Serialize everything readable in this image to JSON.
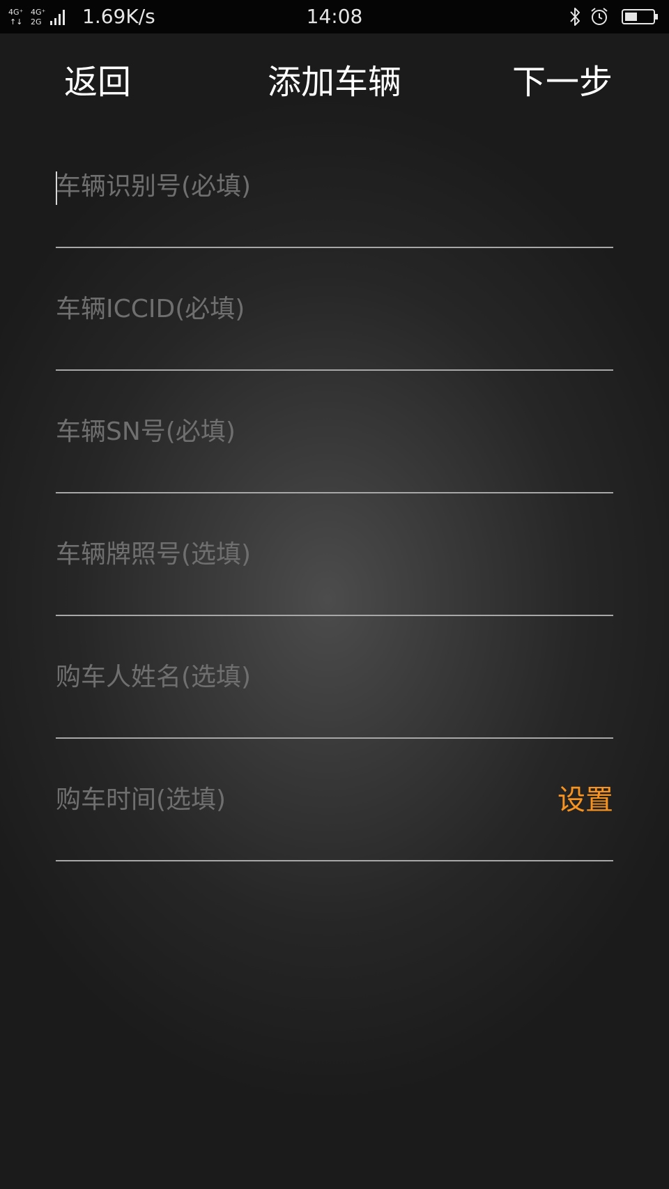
{
  "status_bar": {
    "network_icon": "signal-4g-icon",
    "speed": "1.69K/s",
    "time": "14:08",
    "icons": [
      "bluetooth-icon",
      "alarm-icon",
      "battery-icon"
    ]
  },
  "header": {
    "back_label": "返回",
    "title": "添加车辆",
    "next_label": "下一步"
  },
  "form": {
    "fields": [
      {
        "placeholder": "车辆识别号(必填)",
        "value": ""
      },
      {
        "placeholder": "车辆ICCID(必填)",
        "value": ""
      },
      {
        "placeholder": "车辆SN号(必填)",
        "value": ""
      },
      {
        "placeholder": "车辆牌照号(选填)",
        "value": ""
      },
      {
        "placeholder": "购车人姓名(选填)",
        "value": ""
      },
      {
        "placeholder": "购车时间(选填)",
        "value": ""
      }
    ],
    "set_label": "设置"
  },
  "colors": {
    "accent": "#f7931e",
    "background": "#1b1b1b",
    "placeholder": "#6f6f6f",
    "divider": "#a8a8a8"
  }
}
